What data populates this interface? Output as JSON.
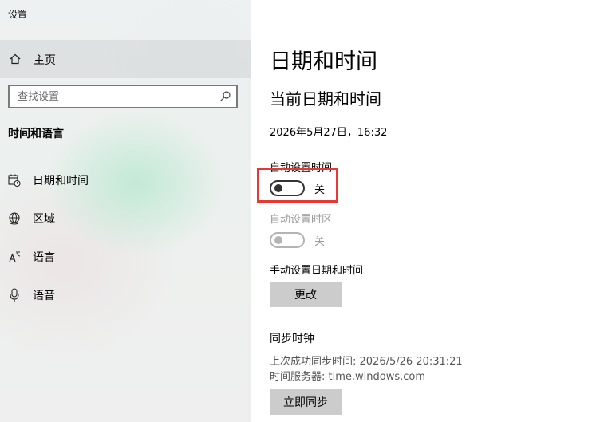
{
  "app": {
    "title": "设置"
  },
  "sidebar": {
    "home_label": "主页",
    "search_placeholder": "查找设置",
    "section_title": "时间和语言",
    "items": [
      {
        "label": "日期和时间",
        "icon": "calendar-clock-icon"
      },
      {
        "label": "区域",
        "icon": "globe-icon"
      },
      {
        "label": "语言",
        "icon": "language-icon"
      },
      {
        "label": "语音",
        "icon": "microphone-icon"
      }
    ]
  },
  "main": {
    "page_title": "日期和时间",
    "sub_title": "当前日期和时间",
    "current_datetime": "2026年5月27日，16:32",
    "auto_time": {
      "label": "自动设置时间",
      "state": "关"
    },
    "auto_timezone": {
      "label": "自动设置时区",
      "state": "关"
    },
    "manual": {
      "label": "手动设置日期和时间",
      "button": "更改"
    },
    "sync": {
      "title": "同步时钟",
      "last_sync": "上次成功同步时间: 2026/5/26 20:31:21",
      "server": "时间服务器: time.windows.com",
      "button": "立即同步"
    },
    "highlight_color": "#e53935"
  }
}
